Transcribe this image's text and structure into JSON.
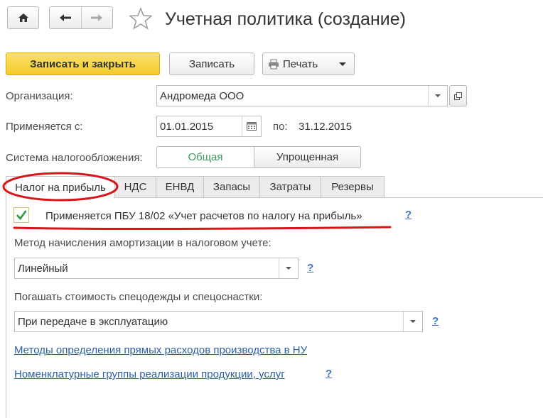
{
  "header": {
    "title": "Учетная политика (создание)"
  },
  "toolbar": {
    "save_close_label": "Записать и закрыть",
    "save_label": "Записать",
    "print_label": "Печать"
  },
  "form": {
    "org_label": "Организация:",
    "org_value": "Андромеда ООО",
    "applies_label": "Применяется с:",
    "applies_from": "01.01.2015",
    "to_label": "по:",
    "applies_to": "31.12.2015",
    "tax_system_label": "Система налогообложения:",
    "tax_options": [
      "Общая",
      "Упрощенная"
    ],
    "tax_selected": "Общая"
  },
  "tabs": [
    "Налог на прибыль",
    "НДС",
    "ЕНВД",
    "Запасы",
    "Затраты",
    "Резервы"
  ],
  "active_tab": "Налог на прибыль",
  "profit_tab": {
    "pbu_checkbox_label": "Применяется ПБУ 18/02 «Учет расчетов по налогу на прибыль»",
    "pbu_checked": true,
    "depreciation_label": "Метод начисления амортизации в налоговом учете:",
    "depreciation_value": "Линейный",
    "workwear_label": "Погашать стоимость спецодежды и спецоснастки:",
    "workwear_value": "При передаче в эксплуатацию",
    "link_direct_costs": "Методы определения прямых расходов производства в НУ",
    "link_nomenclature": "Номенклатурные группы реализации продукции, услуг",
    "help_mark": "?"
  },
  "colors": {
    "primary_button": "#f5d43a",
    "annotation_red": "#d9141b",
    "link": "#2b5fa8",
    "selected_option": "#3a9a5c"
  }
}
